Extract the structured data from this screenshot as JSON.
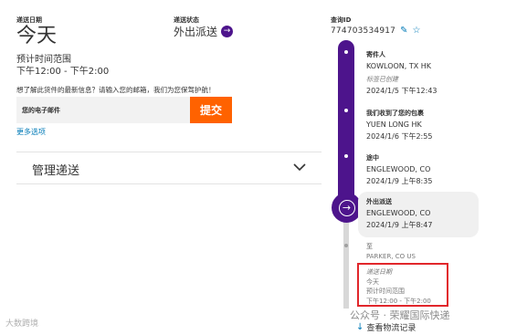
{
  "delivery": {
    "date_label": "递送日期",
    "day": "今天",
    "window_label": "预计时间范围",
    "window": "下午12:00 - 下午2:00"
  },
  "status": {
    "label": "递送状态",
    "value": "外出派送"
  },
  "tracking": {
    "label": "查询ID",
    "number": "774703534917"
  },
  "email_prompt": {
    "text": "想了解此货件的最新信息？请输入您的邮箱，我们为您保驾护航！",
    "input_placeholder": "您的电子邮件",
    "submit_label": "提交",
    "more_options": "更多选项"
  },
  "manage": {
    "title": "管理递送"
  },
  "timeline": {
    "events": [
      {
        "title": "寄件人",
        "location": "KOWLOON, TX HK",
        "note": "标签已创建",
        "date": "2024/1/5 下午12:43"
      },
      {
        "title": "我们收到了您的包裹",
        "location": "YUEN LONG HK",
        "date": "2024/1/6 下午2:55"
      },
      {
        "title": "途中",
        "location": "ENGLEWOOD, CO",
        "date": "2024/1/9 上午8:35"
      },
      {
        "title": "外出派送",
        "location": "ENGLEWOOD, CO",
        "date": "2024/1/9 上午8:47"
      }
    ],
    "destination": {
      "label": "至",
      "location": "PARKER, CO US",
      "date_label": "递送日期",
      "day": "今天",
      "window_label": "预计时间范围",
      "window": "下午12:00 - 下午2:00"
    },
    "history_link": "查看物流记录"
  },
  "watermark": {
    "left": "大数跨境",
    "right": "公众号 · 荣耀国际快递"
  },
  "colors": {
    "fedex_purple": "#4d148c",
    "fedex_orange": "#ff6200",
    "link_blue": "#007ab7",
    "highlight_red": "#e1262b"
  }
}
